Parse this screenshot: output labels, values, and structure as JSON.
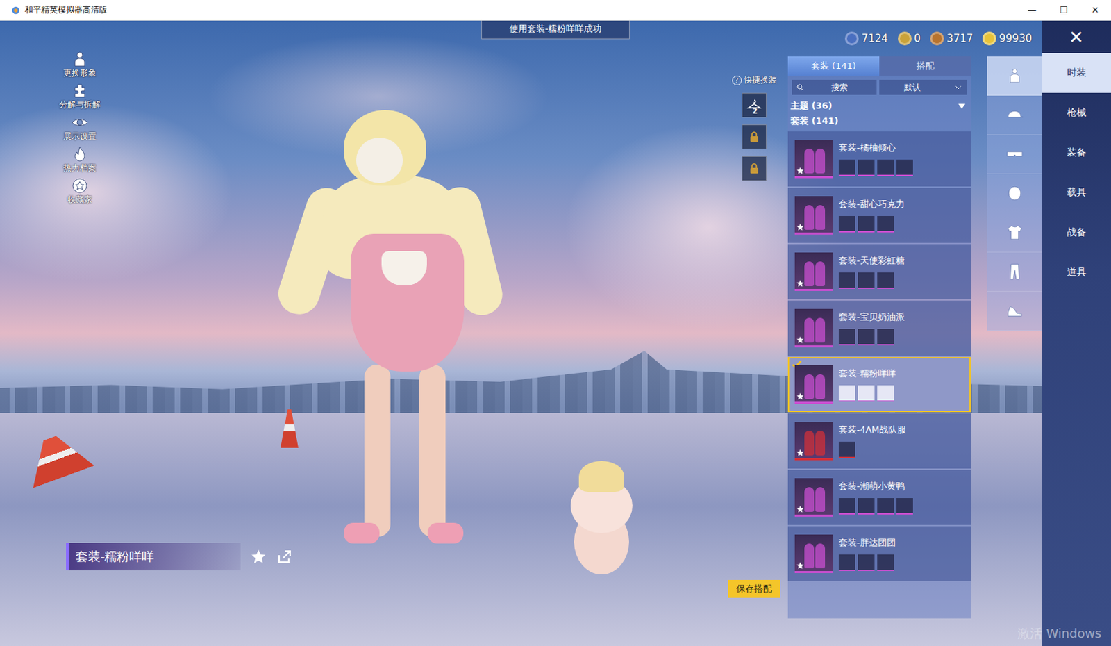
{
  "window": {
    "title": "和平精英模拟器高清版",
    "controls": [
      "—",
      "☐",
      "✕"
    ]
  },
  "toast": "使用套装-糯粉咩咩成功",
  "currencies": [
    {
      "amount": "7124",
      "color": "#4a6fc0"
    },
    {
      "amount": "0",
      "color": "#c9a23a"
    },
    {
      "amount": "3717",
      "color": "#b8732e"
    },
    {
      "amount": "99930",
      "color": "#e8c33a"
    }
  ],
  "close_button": "✕",
  "left_menu": [
    {
      "label": "更换形象"
    },
    {
      "label": "分解与拆解"
    },
    {
      "label": "展示设置"
    },
    {
      "label": "热力档案"
    },
    {
      "label": "收藏家"
    }
  ],
  "quick_change": {
    "help": "?",
    "label": "快捷换装",
    "slots": [
      {
        "number": "2",
        "locked": false
      },
      {
        "number": "",
        "locked": true
      },
      {
        "number": "",
        "locked": true
      }
    ]
  },
  "panel": {
    "tabs": [
      {
        "label": "套装 (141)",
        "selected": true
      },
      {
        "label": "搭配",
        "selected": false
      }
    ],
    "search": {
      "placeholder": "搜索"
    },
    "sort": {
      "value": "默认"
    },
    "theme": {
      "label": "主题 (36)"
    },
    "section": "套装 (141)",
    "items": [
      {
        "name": "套装-橘柚倾心",
        "parts": 4,
        "selected": false,
        "color": "#c84fd0"
      },
      {
        "name": "套装-甜心巧克力",
        "parts": 3,
        "selected": false,
        "color": "#c84fd0"
      },
      {
        "name": "套装-天使彩虹糖",
        "parts": 3,
        "selected": false,
        "color": "#c84fd0"
      },
      {
        "name": "套装-宝贝奶油派",
        "parts": 3,
        "selected": false,
        "color": "#c84fd0"
      },
      {
        "name": "套装-糯粉咩咩",
        "parts": 3,
        "selected": true,
        "color": "#c84fd0"
      },
      {
        "name": "套装-4AM战队服",
        "parts": 1,
        "selected": false,
        "color": "#d0303a"
      },
      {
        "name": "套装-潮萌小黄鸭",
        "parts": 4,
        "selected": false,
        "color": "#c84fd0"
      },
      {
        "name": "套装-胖达团团",
        "parts": 3,
        "selected": false,
        "color": "#c84fd0"
      }
    ]
  },
  "category_icons": [
    {
      "selected": true
    },
    {
      "selected": false
    },
    {
      "selected": false
    },
    {
      "selected": false
    },
    {
      "selected": false
    },
    {
      "selected": false
    },
    {
      "selected": false
    }
  ],
  "categories": [
    {
      "label": "时装",
      "selected": true
    },
    {
      "label": "枪械",
      "selected": false
    },
    {
      "label": "装备",
      "selected": false
    },
    {
      "label": "载具",
      "selected": false
    },
    {
      "label": "战备",
      "selected": false
    },
    {
      "label": "道具",
      "selected": false
    }
  ],
  "showcase": {
    "name": "套装-糯粉咩咩"
  },
  "save_button": "保存搭配",
  "watermark": "激活 Windows"
}
